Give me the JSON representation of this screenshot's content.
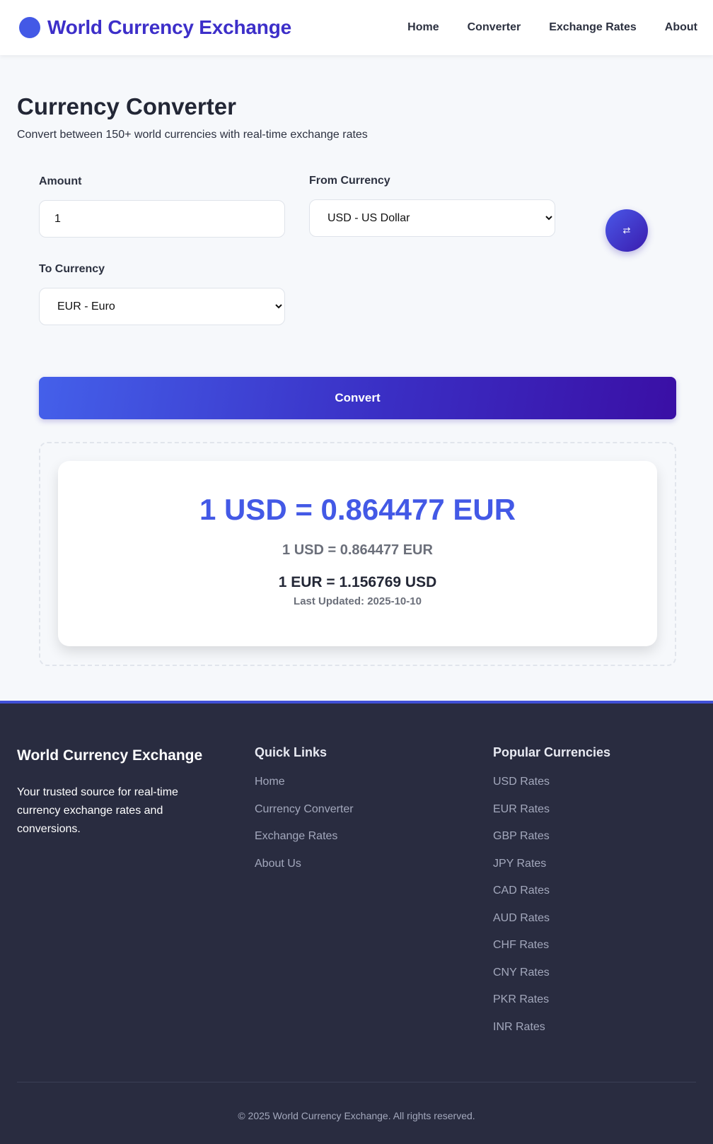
{
  "header": {
    "brand": "World Currency Exchange",
    "nav": [
      "Home",
      "Converter",
      "Exchange Rates",
      "About"
    ]
  },
  "page": {
    "title": "Currency Converter",
    "subtitle": "Convert between 150+ world currencies with real-time exchange rates"
  },
  "form": {
    "amount_label": "Amount",
    "amount_value": "1",
    "from_label": "From Currency",
    "from_selected": "USD - US Dollar",
    "to_label": "To Currency",
    "to_selected": "EUR - Euro",
    "swap_icon": "⇄",
    "convert_label": "Convert"
  },
  "result": {
    "main": "1 USD = 0.864477 EUR",
    "secondary": "1 USD = 0.864477 EUR",
    "inverse": "1 EUR = 1.156769 USD",
    "updated": "Last Updated: 2025-10-10"
  },
  "footer": {
    "brand": "World Currency Exchange",
    "description": "Your trusted source for real-time currency exchange rates and conversions.",
    "quick_links_heading": "Quick Links",
    "quick_links": [
      "Home",
      "Currency Converter",
      "Exchange Rates",
      "About Us"
    ],
    "popular_heading": "Popular Currencies",
    "popular": [
      "USD Rates",
      "EUR Rates",
      "GBP Rates",
      "JPY Rates",
      "CAD Rates",
      "AUD Rates",
      "CHF Rates",
      "CNY Rates",
      "PKR Rates",
      "INR Rates"
    ],
    "copyright": "© 2025 World Currency Exchange. All rights reserved."
  },
  "colors": {
    "accent": "#4359e6",
    "brand": "#3d2fc9",
    "footer_bg": "#292c40"
  }
}
